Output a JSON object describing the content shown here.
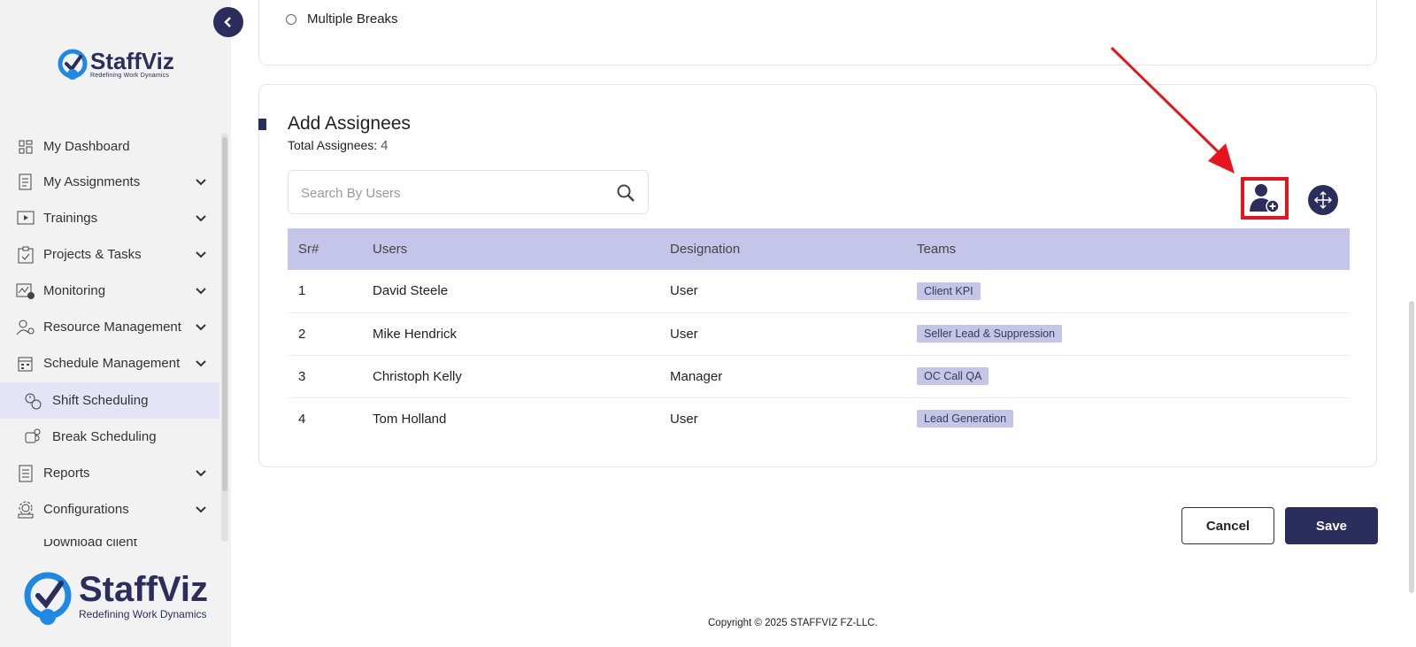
{
  "brand": {
    "name": "StaffViz",
    "tagline_small": "Redefining Work Dynamics",
    "tagline": "Redefining Work Dynamics",
    "color": "#2b2d5c"
  },
  "sidebar": {
    "items": [
      {
        "label": "My Dashboard",
        "icon": "dashboard-icon",
        "has_chevron": false
      },
      {
        "label": "My Assignments",
        "icon": "assignments-icon",
        "has_chevron": true
      },
      {
        "label": "Trainings",
        "icon": "play-icon",
        "has_chevron": true
      },
      {
        "label": "Projects & Tasks",
        "icon": "clipboard-icon",
        "has_chevron": true
      },
      {
        "label": "Monitoring",
        "icon": "monitoring-icon",
        "has_chevron": true
      },
      {
        "label": "Resource Management",
        "icon": "user-gear-icon",
        "has_chevron": true
      },
      {
        "label": "Schedule Management",
        "icon": "calendar-icon",
        "has_chevron": true
      },
      {
        "label": "Shift Scheduling",
        "icon": "shift-icon",
        "sub": true,
        "active": true
      },
      {
        "label": "Break Scheduling",
        "icon": "break-icon",
        "sub": true
      },
      {
        "label": "Reports",
        "icon": "report-icon",
        "has_chevron": true
      },
      {
        "label": "Configurations",
        "icon": "config-icon",
        "has_chevron": true
      }
    ],
    "cut_item": "Download client"
  },
  "break_options": {
    "multiple_breaks_label": "Multiple Breaks"
  },
  "assignees": {
    "title": "Add Assignees",
    "total_label": "Total Assignees:",
    "total_value": "4",
    "search_placeholder": "Search By Users",
    "columns": [
      "Sr#",
      "Users",
      "Designation",
      "Teams"
    ],
    "rows": [
      {
        "sr": "1",
        "user": "David Steele",
        "designation": "User",
        "team": "Client KPI"
      },
      {
        "sr": "2",
        "user": "Mike Hendrick",
        "designation": "User",
        "team": "Seller Lead & Suppression"
      },
      {
        "sr": "3",
        "user": "Christoph Kelly",
        "designation": "Manager",
        "team": "OC Call QA"
      },
      {
        "sr": "4",
        "user": "Tom Holland",
        "designation": "User",
        "team": "Lead Generation"
      }
    ]
  },
  "actions": {
    "cancel": "Cancel",
    "save": "Save"
  },
  "footer": {
    "copyright": "Copyright © 2025 STAFFVIZ FZ-LLC."
  },
  "colors": {
    "accent": "#2b2d5c",
    "table_header": "#c4c5e8",
    "highlight": "#e8141c"
  }
}
